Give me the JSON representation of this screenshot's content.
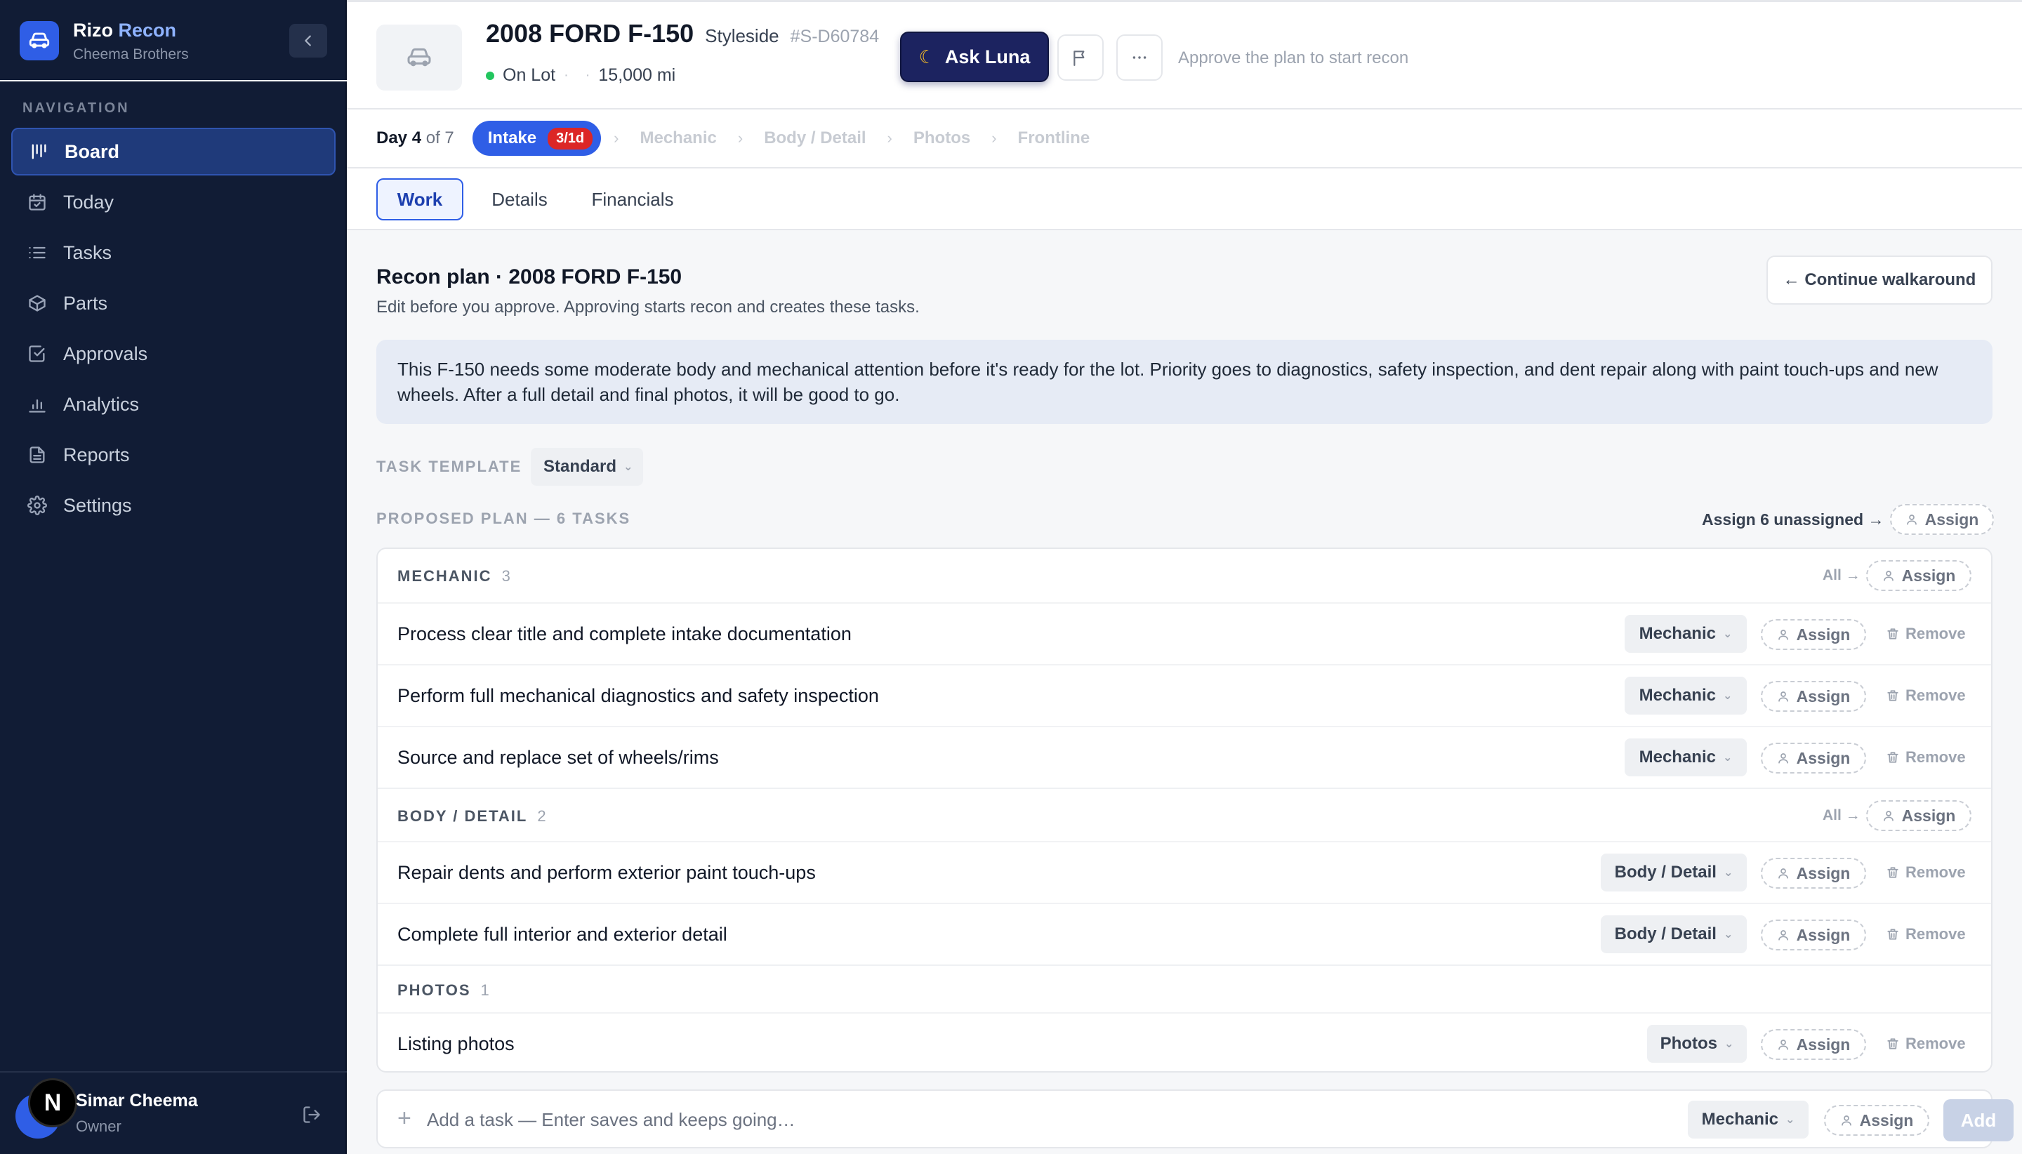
{
  "app": {
    "name": "Rizo",
    "name_accent": "Recon",
    "org": "Cheema Brothers"
  },
  "sidebar": {
    "heading": "NAVIGATION",
    "items": [
      {
        "label": "Board",
        "icon": "board-icon",
        "active": true
      },
      {
        "label": "Today",
        "icon": "calendar-icon"
      },
      {
        "label": "Tasks",
        "icon": "list-icon"
      },
      {
        "label": "Parts",
        "icon": "box-icon"
      },
      {
        "label": "Approvals",
        "icon": "check-square-icon"
      },
      {
        "label": "Analytics",
        "icon": "bar-chart-icon"
      },
      {
        "label": "Reports",
        "icon": "document-icon"
      },
      {
        "label": "Settings",
        "icon": "gear-icon"
      }
    ],
    "user": {
      "name": "Simar Cheema",
      "role": "Owner",
      "badge": "N"
    }
  },
  "vehicle": {
    "title": "2008 FORD F-150",
    "trim": "Styleside",
    "stock": "#S-D60784",
    "status": "On Lot",
    "status_color": "#22c55e",
    "mileage": "15,000 mi"
  },
  "header": {
    "ask_luna": "Ask Luna",
    "approve_hint": "Approve the plan to start recon"
  },
  "stages": {
    "day_current": "Day 4",
    "day_total": "of 7",
    "current": "Intake",
    "current_badge": "3/1d",
    "upcoming": [
      "Mechanic",
      "Body / Detail",
      "Photos",
      "Frontline"
    ]
  },
  "tabs": [
    "Work",
    "Details",
    "Financials"
  ],
  "plan": {
    "title": "Recon plan · 2008 FORD F-150",
    "subtitle": "Edit before you approve. Approving starts recon and creates these tasks.",
    "continue_label": "← Continue walkaround",
    "summary": "This F-150 needs some moderate body and mechanical attention before it's ready for the lot. Priority goes to diagnostics, safety inspection, and dent repair along with paint touch-ups and new wheels. After a full detail and final photos, it will be good to go.",
    "template_label": "TASK TEMPLATE",
    "template_value": "Standard",
    "proposed_label": "PROPOSED PLAN — 6 TASKS",
    "assign_unassigned": "Assign 6 unassigned →",
    "assign_label": "Assign",
    "all_label": "All →",
    "remove_label": "Remove",
    "groups": [
      {
        "name": "MECHANIC",
        "count": "3",
        "tasks": [
          {
            "title": "Process clear title and complete intake documentation",
            "role": "Mechanic"
          },
          {
            "title": "Perform full mechanical diagnostics and safety inspection",
            "role": "Mechanic"
          },
          {
            "title": "Source and replace set of wheels/rims",
            "role": "Mechanic"
          }
        ]
      },
      {
        "name": "BODY / DETAIL",
        "count": "2",
        "tasks": [
          {
            "title": "Repair dents and perform exterior paint touch-ups",
            "role": "Body / Detail"
          },
          {
            "title": "Complete full interior and exterior detail",
            "role": "Body / Detail"
          }
        ]
      },
      {
        "name": "PHOTOS",
        "count": "1",
        "tasks": [
          {
            "title": "Listing photos",
            "role": "Photos"
          }
        ]
      }
    ]
  },
  "add_task": {
    "placeholder": "Add a task — Enter saves and keeps going…",
    "role": "Mechanic",
    "assign": "Assign",
    "button": "Add"
  },
  "colors": {
    "sidebar_bg": "#111c35",
    "accent": "#2f5ee6",
    "luna_bg": "#1c2360",
    "badge_red": "#dc2626"
  }
}
